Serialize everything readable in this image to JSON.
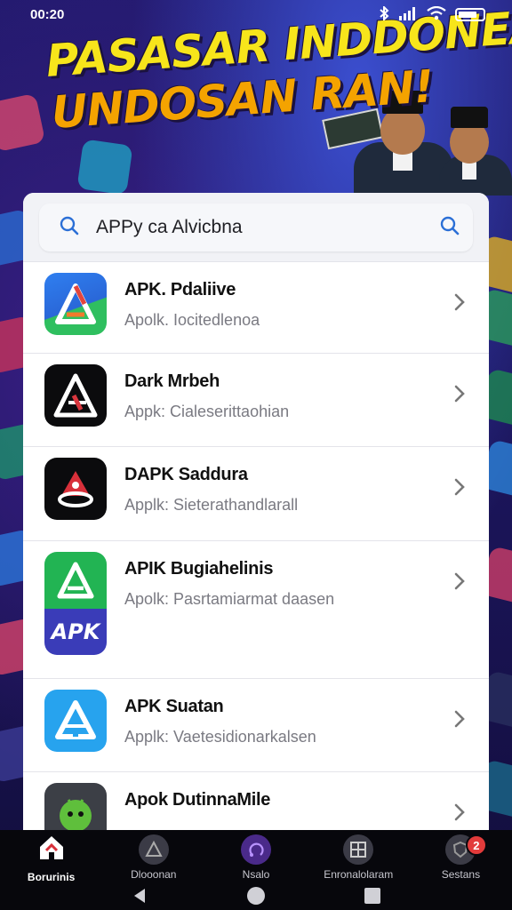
{
  "status_bar": {
    "time": "00:20",
    "icons": [
      "bluetooth-icon",
      "signal-icon",
      "wifi-icon",
      "battery-icon"
    ]
  },
  "banner": {
    "line1": "PASASAR INDDONEAN",
    "line2": "UNDOSAN RAN!"
  },
  "search": {
    "query": "APPy ca Alvicbna"
  },
  "apps": [
    {
      "name": "APK. Pdaliive",
      "subtitle": "Apolk. Iocitedlenoa",
      "icon": "apk-a-green-icon"
    },
    {
      "name": "Dark Mrbeh",
      "subtitle": "Appk: Cialeserittaohian",
      "icon": "dark-a-icon"
    },
    {
      "name": "DAPK Saddura",
      "subtitle": "Applk: Sieterathandlarall",
      "icon": "red-triangle-icon"
    },
    {
      "name": "APIK Bugiahelinis",
      "subtitle": "Apolk: Pasrtamiarmat daasen",
      "icon": "apk-green-purple-icon",
      "icon_text": "APK"
    },
    {
      "name": "APK Suatan",
      "subtitle": "Applk: Vaetesidionarkalsen",
      "icon": "apk-blue-icon"
    },
    {
      "name": "Apok DutinnaMile",
      "subtitle": "",
      "icon": "android-icon"
    }
  ],
  "bottom_nav": [
    {
      "label": "Borurinis",
      "icon": "home-icon",
      "active": true
    },
    {
      "label": "Dlooonan",
      "icon": "triangle-icon"
    },
    {
      "label": "Nsalo",
      "icon": "orbit-icon"
    },
    {
      "label": "Enronalolaram",
      "icon": "grid-icon"
    },
    {
      "label": "Sestans",
      "icon": "shield-icon",
      "badge": "2"
    }
  ],
  "colors": {
    "accent_blue": "#2b6fd6",
    "badge_red": "#e23b3b",
    "banner_yellow": "#f7e51b",
    "banner_orange": "#f4a300"
  }
}
